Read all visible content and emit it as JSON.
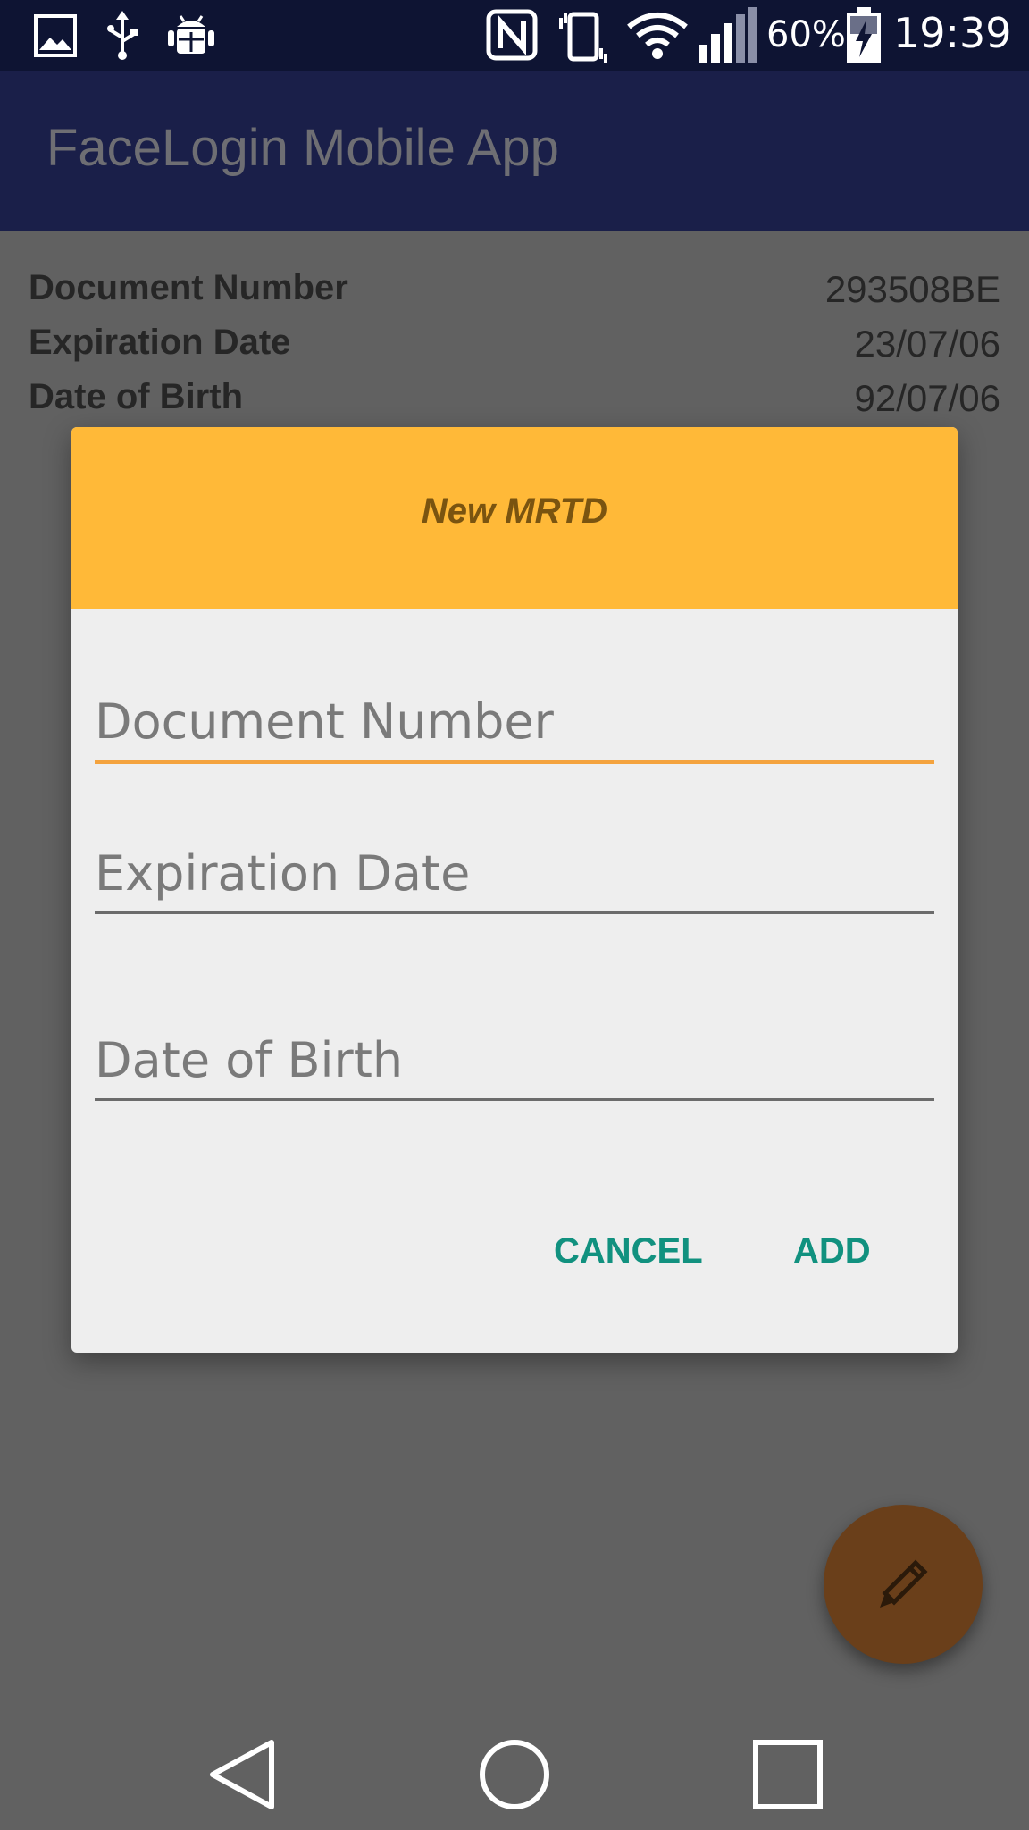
{
  "status_bar": {
    "icons_left": [
      "gallery-icon",
      "usb-icon",
      "android-debug-icon"
    ],
    "icons_right": [
      "nfc-icon",
      "vibrate-icon",
      "wifi-icon",
      "signal-icon",
      "battery-charging-icon"
    ],
    "battery_percent": "60%",
    "time": "19:39"
  },
  "toolbar": {
    "title": "FaceLogin Mobile App"
  },
  "info": {
    "rows": [
      {
        "label": "Document Number",
        "value": "293508BE"
      },
      {
        "label": "Expiration Date",
        "value": "23/07/06"
      },
      {
        "label": "Date of Birth",
        "value": "92/07/06"
      }
    ]
  },
  "dialog": {
    "title": "New MRTD",
    "header_color": "#ffb938",
    "fields": [
      {
        "placeholder": "Document Number",
        "value": ""
      },
      {
        "placeholder": "Expiration Date",
        "value": ""
      },
      {
        "placeholder": "Date of Birth",
        "value": ""
      }
    ],
    "cancel_label": "CANCEL",
    "add_label": "ADD",
    "button_color": "#11917f"
  },
  "fab": {
    "icon": "pencil-icon"
  },
  "navbar": {
    "buttons": [
      "back-icon",
      "home-icon",
      "recents-icon"
    ]
  }
}
